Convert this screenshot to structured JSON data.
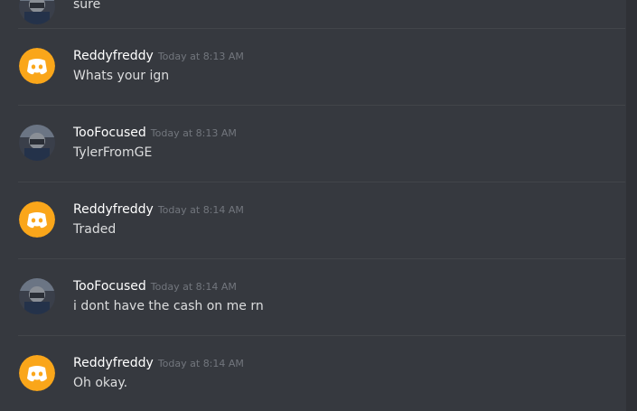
{
  "colors": {
    "background": "#36393f",
    "divider": "#42454a",
    "username": "#ffffff",
    "timestamp": "#72767d",
    "message_text": "#dcddde",
    "discord_avatar_bg": "#faa61a"
  },
  "partial_message": {
    "content": "sure"
  },
  "messages": [
    {
      "username": "Reddyfreddy",
      "timestamp": "Today at 8:13 AM",
      "content": "Whats your ign",
      "avatar_icon": "discord-default-avatar-icon"
    },
    {
      "username": "TooFocused",
      "timestamp": "Today at 8:13 AM",
      "content": "TylerFromGE",
      "avatar_icon": "user-photo-avatar"
    },
    {
      "username": "Reddyfreddy",
      "timestamp": "Today at 8:14 AM",
      "content": "Traded",
      "avatar_icon": "discord-default-avatar-icon"
    },
    {
      "username": "TooFocused",
      "timestamp": "Today at 8:14 AM",
      "content": "i dont have the cash on me rn",
      "avatar_icon": "user-photo-avatar"
    },
    {
      "username": "Reddyfreddy",
      "timestamp": "Today at 8:14 AM",
      "content": "Oh okay.",
      "avatar_icon": "discord-default-avatar-icon"
    }
  ]
}
